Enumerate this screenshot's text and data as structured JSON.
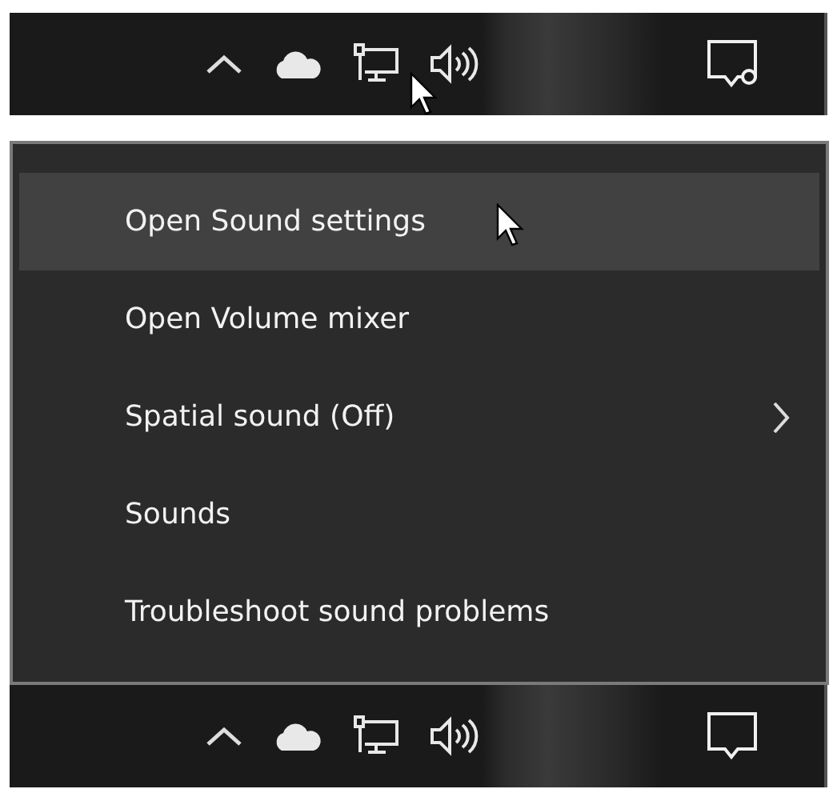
{
  "taskbar_top": {
    "notification_badge": true,
    "pointer": true
  },
  "menu": {
    "items": [
      {
        "label": "Open Sound settings",
        "selected": true,
        "submenu": false
      },
      {
        "label": "Open Volume mixer",
        "selected": false,
        "submenu": false
      },
      {
        "label": "Spatial sound (Off)",
        "selected": false,
        "submenu": true
      },
      {
        "label": "Sounds",
        "selected": false,
        "submenu": false
      },
      {
        "label": "Troubleshoot sound problems",
        "selected": false,
        "submenu": false
      }
    ]
  },
  "taskbar_bottom": {
    "notification_badge": false,
    "pointer": false
  }
}
